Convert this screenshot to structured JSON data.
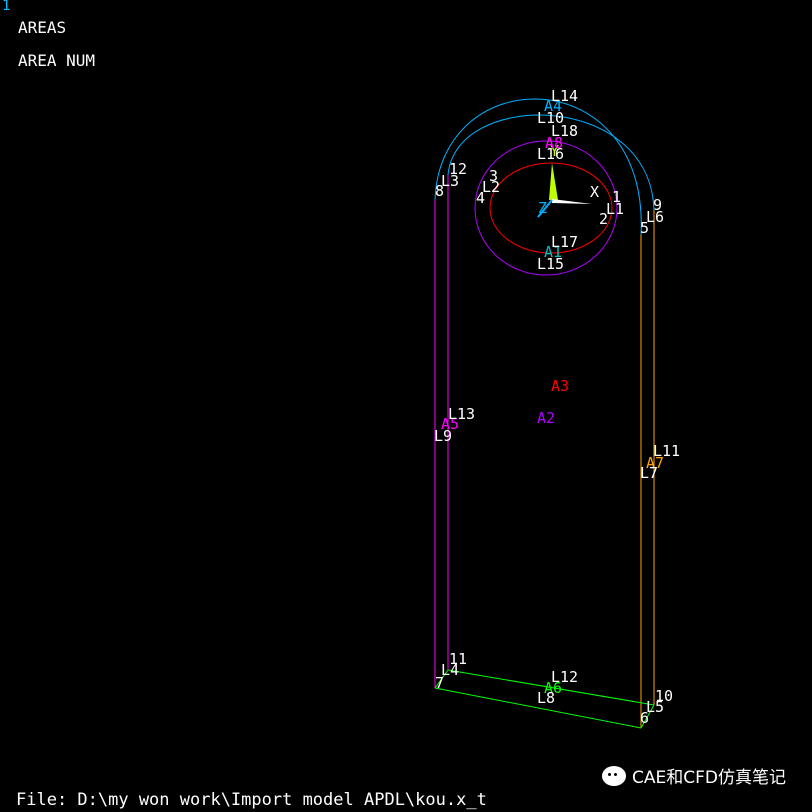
{
  "window_number": "1",
  "plot_title": "AREAS",
  "plot_subtitle": "AREA NUM",
  "file_info": "File: D:\\my won work\\Import model APDL\\kou.x_t",
  "watermark": "CAE和CFD仿真笔记",
  "colors": {
    "background": "#000000",
    "text": "#ffffff",
    "magenta": "#ff00ff",
    "purple": "#b000ff",
    "orange": "#ffa500",
    "green": "#00ff00",
    "blue": "#00b0ff",
    "red": "#ff0000",
    "triad_y": "#c0ff00"
  },
  "triad": {
    "x": "X",
    "y": "Y",
    "z": "Z"
  },
  "areas": {
    "A1": "A1",
    "A2": "A2",
    "A3": "A3",
    "A4": "A4",
    "A5": "A5",
    "A6": "A6",
    "A7": "A7",
    "A8": "A8"
  },
  "lines": {
    "L1": "L1",
    "L2": "L2",
    "L3": "L3",
    "L4": "L4",
    "L5": "L5",
    "L6": "L6",
    "L7": "L7",
    "L8": "L8",
    "L9": "L9",
    "L10": "L10",
    "L11": "L11",
    "L12": "L12",
    "L13": "L13",
    "L14": "L14",
    "L15": "L15",
    "L16": "L16",
    "L17": "L17",
    "L18": "L18"
  },
  "keypoints": {
    "k1": "1",
    "k2": "2",
    "k3": "3",
    "k4": "4",
    "k5": "5",
    "k6": "6",
    "k7": "7",
    "k8": "8",
    "k9": "9",
    "k10": "10",
    "k11": "11",
    "k12": "12"
  }
}
